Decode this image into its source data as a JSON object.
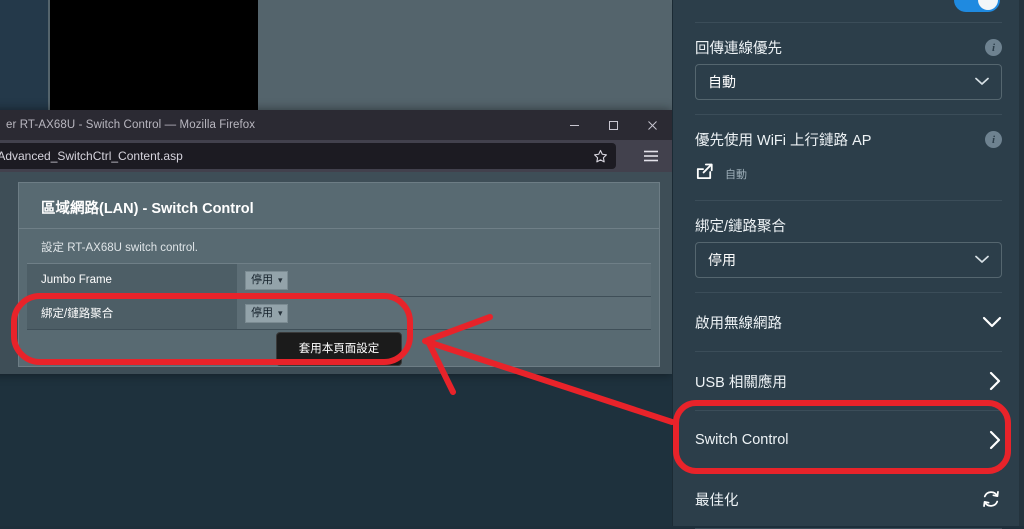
{
  "window": {
    "title": "er RT-AX68U - Switch Control — Mozilla Firefox",
    "url": "/Advanced_SwitchCtrl_Content.asp",
    "minimize_label": "minimize",
    "maximize_label": "maximize",
    "close_label": "close",
    "bookmark_label": "bookmark",
    "menu_label": "application menu"
  },
  "router_page": {
    "card_title": "區域網路(LAN) - Switch Control",
    "card_description": "設定 RT-AX68U switch control.",
    "rows": [
      {
        "label": "Jumbo Frame",
        "value": "停用"
      },
      {
        "label": "綁定/鏈路聚合",
        "value": "停用"
      }
    ],
    "apply_button": "套用本頁面設定"
  },
  "app_panel": {
    "toggle": {
      "name": "wifi-toggle",
      "state": "on"
    },
    "sections": [
      {
        "type": "select",
        "label": "回傳連線優先",
        "has_info": true,
        "value": "自動"
      },
      {
        "type": "link",
        "label": "優先使用 WiFi 上行鏈路 AP",
        "has_info": true,
        "value": "自動"
      },
      {
        "type": "select",
        "label": "綁定/鏈路聚合",
        "has_info": false,
        "value": "停用"
      }
    ],
    "nav_items": [
      {
        "label": "啟用無線網路",
        "icon": "chevron-down-icon",
        "highlighted": false
      },
      {
        "label": "USB 相關應用",
        "icon": "chevron-right-icon",
        "highlighted": false
      },
      {
        "label": "Switch Control",
        "icon": "chevron-right-icon",
        "highlighted": true
      },
      {
        "label": "最佳化",
        "icon": "refresh-icon",
        "highlighted": false
      }
    ]
  },
  "annotation": {
    "color": "#e8232a",
    "shapes": [
      "highlight-box-switch-control",
      "highlight-box-table-row",
      "arrow-pointing-left"
    ]
  }
}
